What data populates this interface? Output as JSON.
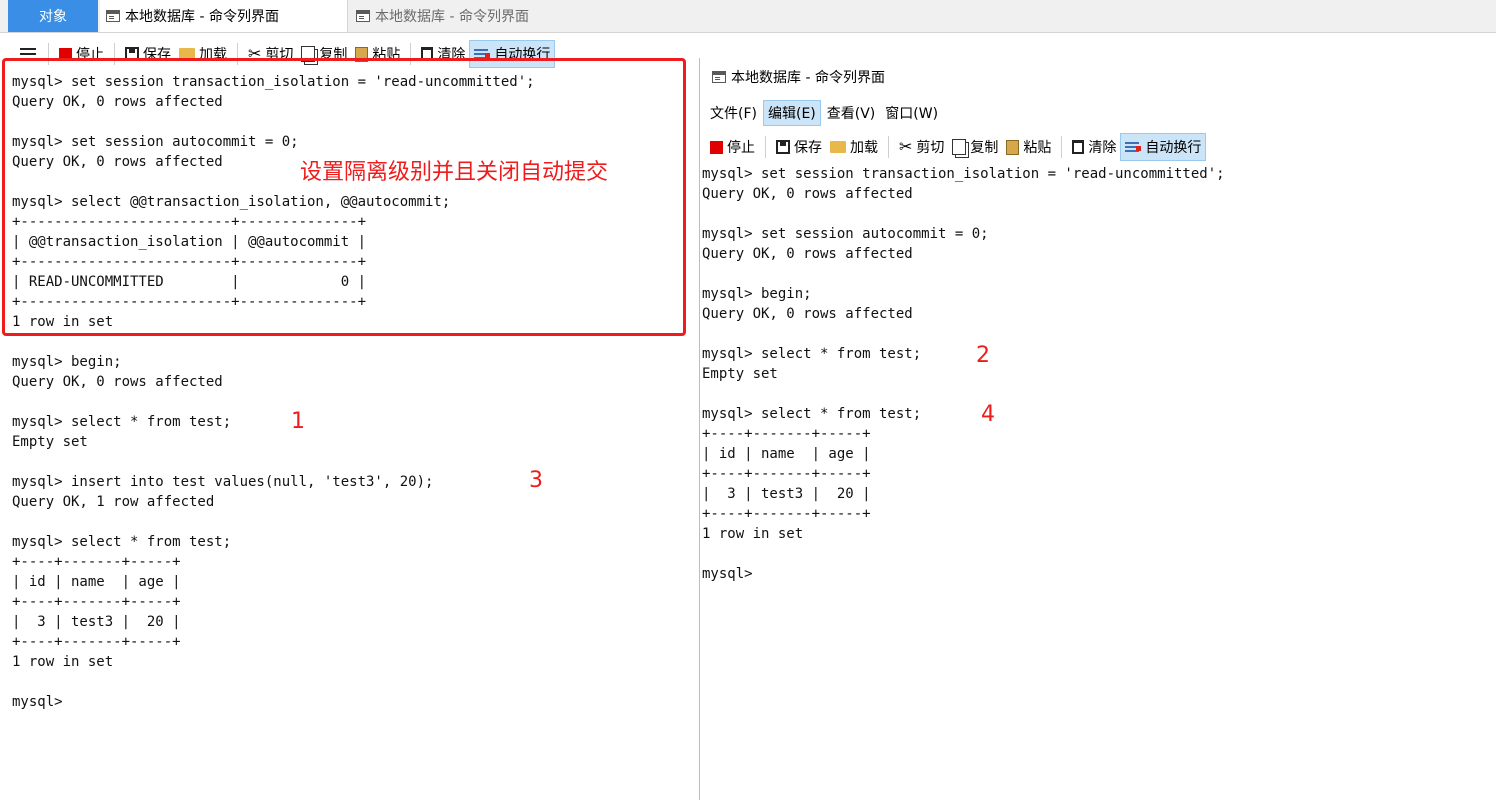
{
  "tabs": {
    "objects": "对象",
    "cmd_1": "本地数据库 - 命令列界面",
    "cmd_2": "本地数据库 - 命令列界面"
  },
  "toolbar": {
    "stop": "停止",
    "save": "保存",
    "load": "加载",
    "cut": "剪切",
    "copy": "复制",
    "paste": "粘贴",
    "clear": "清除",
    "wrap": "自动换行"
  },
  "right_window": {
    "title": "本地数据库 - 命令列界面",
    "menu": [
      "文件(F)",
      "编辑(E)",
      "查看(V)",
      "窗口(W)"
    ]
  },
  "left_terminal": "mysql> set session transaction_isolation = 'read-uncommitted';\nQuery OK, 0 rows affected\n\nmysql> set session autocommit = 0;\nQuery OK, 0 rows affected\n\nmysql> select @@transaction_isolation, @@autocommit;\n+-------------------------+--------------+\n| @@transaction_isolation | @@autocommit |\n+-------------------------+--------------+\n| READ-UNCOMMITTED        |            0 |\n+-------------------------+--------------+\n1 row in set\n\nmysql> begin;\nQuery OK, 0 rows affected\n\nmysql> select * from test;\nEmpty set\n\nmysql> insert into test values(null, 'test3', 20);\nQuery OK, 1 row affected\n\nmysql> select * from test;\n+----+-------+-----+\n| id | name  | age |\n+----+-------+-----+\n|  3 | test3 |  20 |\n+----+-------+-----+\n1 row in set\n\nmysql>",
  "right_terminal": "mysql> set session transaction_isolation = 'read-uncommitted';\nQuery OK, 0 rows affected\n\nmysql> set session autocommit = 0;\nQuery OK, 0 rows affected\n\nmysql> begin;\nQuery OK, 0 rows affected\n\nmysql> select * from test;\nEmpty set\n\nmysql> select * from test;\n+----+-------+-----+\n| id | name  | age |\n+----+-------+-----+\n|  3 | test3 |  20 |\n+----+-------+-----+\n1 row in set\n\nmysql>",
  "annotations": {
    "main": "设置隔离级别并且关闭自动提交",
    "step1": "1",
    "step2": "2",
    "step3": "3",
    "step4": "4"
  },
  "colors": {
    "annotation": "#ee1c1c",
    "tab_active": "#3a8ee6",
    "button_active": "#cce4f7"
  }
}
